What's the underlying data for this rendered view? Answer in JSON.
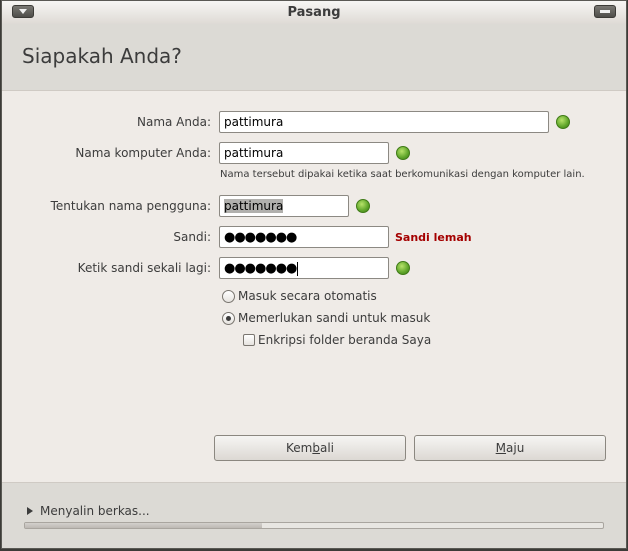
{
  "window": {
    "title": "Pasang"
  },
  "header": {
    "title": "Siapakah Anda?"
  },
  "form": {
    "name": {
      "label": "Nama Anda:",
      "value": "pattimura",
      "status": "valid"
    },
    "computer": {
      "label": "Nama komputer Anda:",
      "value": "pattimura",
      "status": "valid",
      "hint": "Nama tersebut dipakai ketika saat berkomunikasi dengan komputer lain."
    },
    "username": {
      "label": "Tentukan nama pengguna:",
      "value": "pattimura",
      "status": "valid"
    },
    "password": {
      "label": "Sandi:",
      "value": "●●●●●●●",
      "strength": "Sandi lemah"
    },
    "confirm": {
      "label": "Ketik sandi sekali lagi:",
      "value": "●●●●●●●",
      "status": "valid"
    },
    "login_options": [
      {
        "label": "Masuk secara otomatis",
        "selected": false
      },
      {
        "label": "Memerlukan sandi untuk masuk",
        "selected": true
      }
    ],
    "encrypt": {
      "label": "Enkripsi folder beranda Saya",
      "checked": false
    }
  },
  "buttons": {
    "back": {
      "pre": "Kem",
      "mnemonic": "b",
      "post": "ali"
    },
    "next": {
      "pre": "",
      "mnemonic": "M",
      "post": "aju"
    }
  },
  "footer": {
    "expander_label": "Menyalin berkas...",
    "progress_fraction": 0.41
  },
  "colors": {
    "valid": "#5fa52a",
    "weak": "#a40000"
  }
}
